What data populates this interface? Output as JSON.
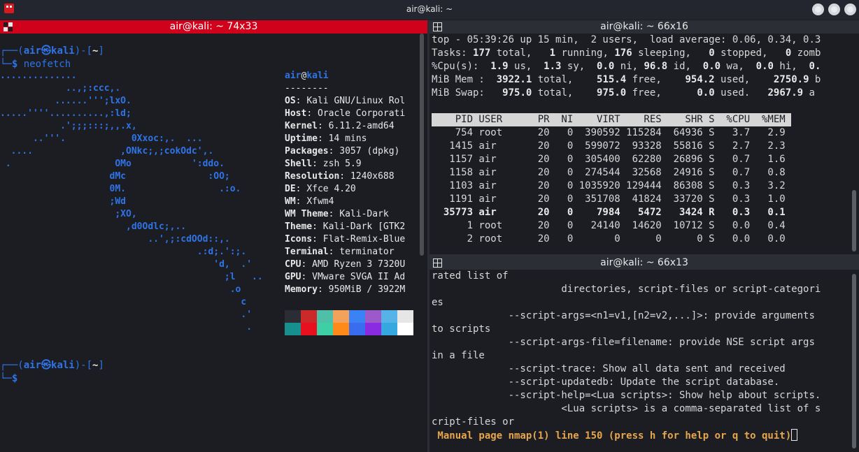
{
  "window": {
    "title": "air@kali: ~"
  },
  "left": {
    "title": "air@kali: ~ 74x33",
    "prompt1": {
      "open": "┌──(",
      "user": "air",
      "host": "kali",
      "close": ")-[",
      "dir": "~",
      "end": "]",
      "line2": "└─",
      "dollar": "$",
      "cmd": " neofetch"
    },
    "prompt2": {
      "open": "┌──(",
      "user": "air",
      "host": "kali",
      "close": ")-[",
      "dir": "~",
      "end": "]",
      "line2": "└─",
      "dollar": "$"
    },
    "logo_lines": [
      "..............",
      "            ..,;:ccc,.",
      "          ......''';lxO.",
      ".....''''..........,:ld;",
      "           .';;;:::;,,.x,",
      "      ..'''.            0Xxoc:,.  ...",
      "  ....                ,ONkc;,;cokOdc',.",
      " .                   OMo           ':ddo.",
      "                    dMc               :OO;",
      "                    0M.                 .:o.",
      "                    ;Wd",
      "                     ;XO,",
      "                       ,d0Odlc;,..",
      "                           ..',;:cdOOd::,.",
      "                                    .:d;.':;.",
      "                                       'd,  .'",
      "                                         ;l   ..",
      "                                          .o",
      "                                            c",
      "                                            .'",
      "                                             ."
    ],
    "neofetch": {
      "user": "air",
      "at": "@",
      "host": "kali",
      "separator": "--------",
      "rows": [
        {
          "key": "OS",
          "value": "Kali GNU/Linux Rol"
        },
        {
          "key": "Host",
          "value": "Oracle Corporati"
        },
        {
          "key": "Kernel",
          "value": "6.11.2-amd64"
        },
        {
          "key": "Uptime",
          "value": "14 mins"
        },
        {
          "key": "Packages",
          "value": "3057 (dpkg)"
        },
        {
          "key": "Shell",
          "value": "zsh 5.9"
        },
        {
          "key": "Resolution",
          "value": "1240x688"
        },
        {
          "key": "DE",
          "value": "Xfce 4.20"
        },
        {
          "key": "WM",
          "value": "Xfwm4"
        },
        {
          "key": "WM Theme",
          "value": "Kali-Dark"
        },
        {
          "key": "Theme",
          "value": "Kali-Dark [GTK2"
        },
        {
          "key": "Icons",
          "value": "Flat-Remix-Blue"
        },
        {
          "key": "Terminal",
          "value": "terminator"
        },
        {
          "key": "CPU",
          "value": "AMD Ryzen 3 7320U"
        },
        {
          "key": "GPU",
          "value": "VMware SVGA II Ad"
        },
        {
          "key": "Memory",
          "value": "950MiB / 3922M"
        }
      ],
      "palette_dark": [
        "#2a2d33",
        "#cc2a2a",
        "#4fbfa8",
        "#f2a25a",
        "#3b82f6",
        "#9b59c9",
        "#55b3e8",
        "#e6e6e6"
      ],
      "palette_bright": [
        "#178f8f",
        "#e8101e",
        "#3ecfa5",
        "#ff8a1a",
        "#3a6cf0",
        "#8a2be2",
        "#36a8e0",
        "#ffffff"
      ]
    }
  },
  "top": {
    "title": "air@kali: ~ 66x16",
    "summary": {
      "line1": "top - 05:39:26 up 15 min,  2 users,  load average: 0.06, 0.34, 0.3",
      "tasks": [
        "Tasks: ",
        "177",
        " total,   ",
        "1",
        " running, ",
        "176",
        " sleeping,   ",
        "0",
        " stopped,   ",
        "0",
        " zomb"
      ],
      "cpu": [
        "%Cpu(s):  ",
        "1.9",
        " us,  ",
        "1.3",
        " sy,  ",
        "0.0",
        " ni, ",
        "96.8",
        " id,  ",
        "0.0",
        " wa,  ",
        "0.0",
        " hi,  ",
        "0."
      ],
      "mem": [
        "MiB Mem :  ",
        "3922.1",
        " total,    ",
        "515.4",
        " free,    ",
        "954.2",
        " used,    ",
        "2750.9",
        " b"
      ],
      "swap": [
        "MiB Swap:   ",
        "975.0",
        " total,    ",
        "975.0",
        " free,      ",
        "0.0",
        " used.   ",
        "2967.9",
        " a"
      ]
    },
    "header": "    PID USER      PR  NI    VIRT    RES    SHR S  %CPU  %MEM ",
    "processes": [
      {
        "line": "    754 root      20   0  390592 115284  64936 S   3.7   2.9",
        "bold": false
      },
      {
        "line": "   1415 air       20   0  599072  93328  55816 S   2.7   2.3",
        "bold": false
      },
      {
        "line": "   1157 air       20   0  305400  62280  26896 S   0.7   1.6",
        "bold": false
      },
      {
        "line": "   1158 air       20   0  274544  32568  24916 S   0.7   0.8",
        "bold": false
      },
      {
        "line": "   1103 air       20   0 1035920 129444  86308 S   0.3   3.2",
        "bold": false
      },
      {
        "line": "   1191 air       20   0  351708  41824  33720 S   0.3   1.0",
        "bold": false
      },
      {
        "line": "  35773 air       20   0    7984   5472   3424 R   0.3   0.1",
        "bold": true
      },
      {
        "line": "      1 root      20   0   24140  14620  10712 S   0.0   0.4",
        "bold": false
      },
      {
        "line": "      2 root      20   0       0      0      0 S   0.0   0.0",
        "bold": false
      }
    ]
  },
  "man": {
    "title": "air@kali: ~ 66x13",
    "lines": [
      "rated list of",
      "                      directories, script-files or script-categori",
      "es",
      "             --script-args=<n1=v1,[n2=v2,...]>: provide arguments",
      "to scripts",
      "             --script-args-file=filename: provide NSE script args",
      "in a file",
      "             --script-trace: Show all data sent and received",
      "             --script-updatedb: Update the script database.",
      "             --script-help=<Lua scripts>: Show help about scripts.",
      "                      <Lua scripts> is a comma-separated list of s",
      "cript-files or"
    ],
    "status": " Manual page nmap(1) line 150 (press h for help or q to quit)"
  }
}
